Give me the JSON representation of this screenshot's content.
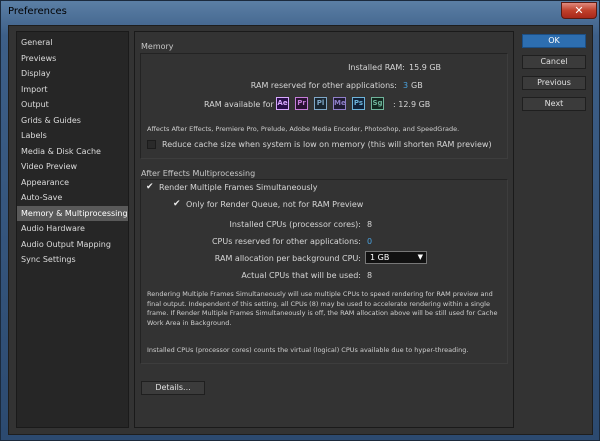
{
  "window": {
    "title": "Preferences",
    "close_glyph": "✕"
  },
  "sidebar": {
    "items": [
      {
        "label": "General"
      },
      {
        "label": "Previews"
      },
      {
        "label": "Display"
      },
      {
        "label": "Import"
      },
      {
        "label": "Output"
      },
      {
        "label": "Grids & Guides"
      },
      {
        "label": "Labels"
      },
      {
        "label": "Media & Disk Cache"
      },
      {
        "label": "Video Preview"
      },
      {
        "label": "Appearance"
      },
      {
        "label": "Auto-Save"
      },
      {
        "label": "Memory & Multiprocessing",
        "selected": true
      },
      {
        "label": "Audio Hardware"
      },
      {
        "label": "Audio Output Mapping"
      },
      {
        "label": "Sync Settings"
      }
    ]
  },
  "memory": {
    "group_title": "Memory",
    "installed_label": "Installed RAM:",
    "installed_value": "15.9 GB",
    "reserved_label": "RAM reserved for other applications:",
    "reserved_value": "3",
    "reserved_unit": "GB",
    "available_label": "RAM available for",
    "available_value": ": 12.9 GB",
    "apps": [
      {
        "abbr": "Ae",
        "color": "#d8a8ff",
        "bg": "#2a0f4a",
        "icon": "after-effects-icon"
      },
      {
        "abbr": "Pr",
        "color": "#c47dd8",
        "bg": "#2a1232",
        "icon": "premiere-pro-icon"
      },
      {
        "abbr": "Pl",
        "color": "#7fa8c8",
        "bg": "#1a2630",
        "icon": "prelude-icon"
      },
      {
        "abbr": "Me",
        "color": "#8f7fc8",
        "bg": "#1f1a32",
        "icon": "media-encoder-icon"
      },
      {
        "abbr": "Ps",
        "color": "#6db3d9",
        "bg": "#10233a",
        "icon": "photoshop-icon"
      },
      {
        "abbr": "Sg",
        "color": "#6fb39a",
        "bg": "#13281f",
        "icon": "speedgrade-icon"
      }
    ],
    "affects_text": "Affects After Effects, Premiere Pro, Prelude, Adobe Media Encoder, Photoshop, and SpeedGrade.",
    "reduce_cache_label": "Reduce cache size when system is low on memory (this will shorten RAM preview)",
    "reduce_cache_checked": false
  },
  "multiprocessing": {
    "group_title": "After Effects Multiprocessing",
    "render_multi_label": "Render Multiple Frames Simultaneously",
    "render_multi_checked": true,
    "only_render_queue_label": "Only for Render Queue, not for RAM Preview",
    "only_render_queue_checked": true,
    "installed_cpus_label": "Installed CPUs (processor cores):",
    "installed_cpus_value": "8",
    "reserved_cpus_label": "CPUs reserved for other applications:",
    "reserved_cpus_value": "0",
    "ram_alloc_label": "RAM allocation per background CPU:",
    "ram_alloc_value": "1 GB",
    "actual_cpus_label": "Actual CPUs that will be used:",
    "actual_cpus_value": "8",
    "info_text": "Rendering Multiple Frames Simultaneously will use multiple CPUs to speed rendering for RAM preview and final output. Independent of this setting, all CPUs (8) may be used to accelerate rendering within a single frame. If Render Multiple Frames Simultaneously is off, the RAM allocation above will be still used for Cache Work Area in Background.",
    "cores_text": "Installed CPUs (processor cores) counts the virtual (logical) CPUs available due to hyper-threading."
  },
  "details_button": "Details...",
  "buttons": {
    "ok": "OK",
    "cancel": "Cancel",
    "previous": "Previous",
    "next": "Next"
  },
  "colors": {
    "accent_blue": "#4aa3e0",
    "ok_button": "#2d6eb0",
    "selected_row": "#595959"
  }
}
